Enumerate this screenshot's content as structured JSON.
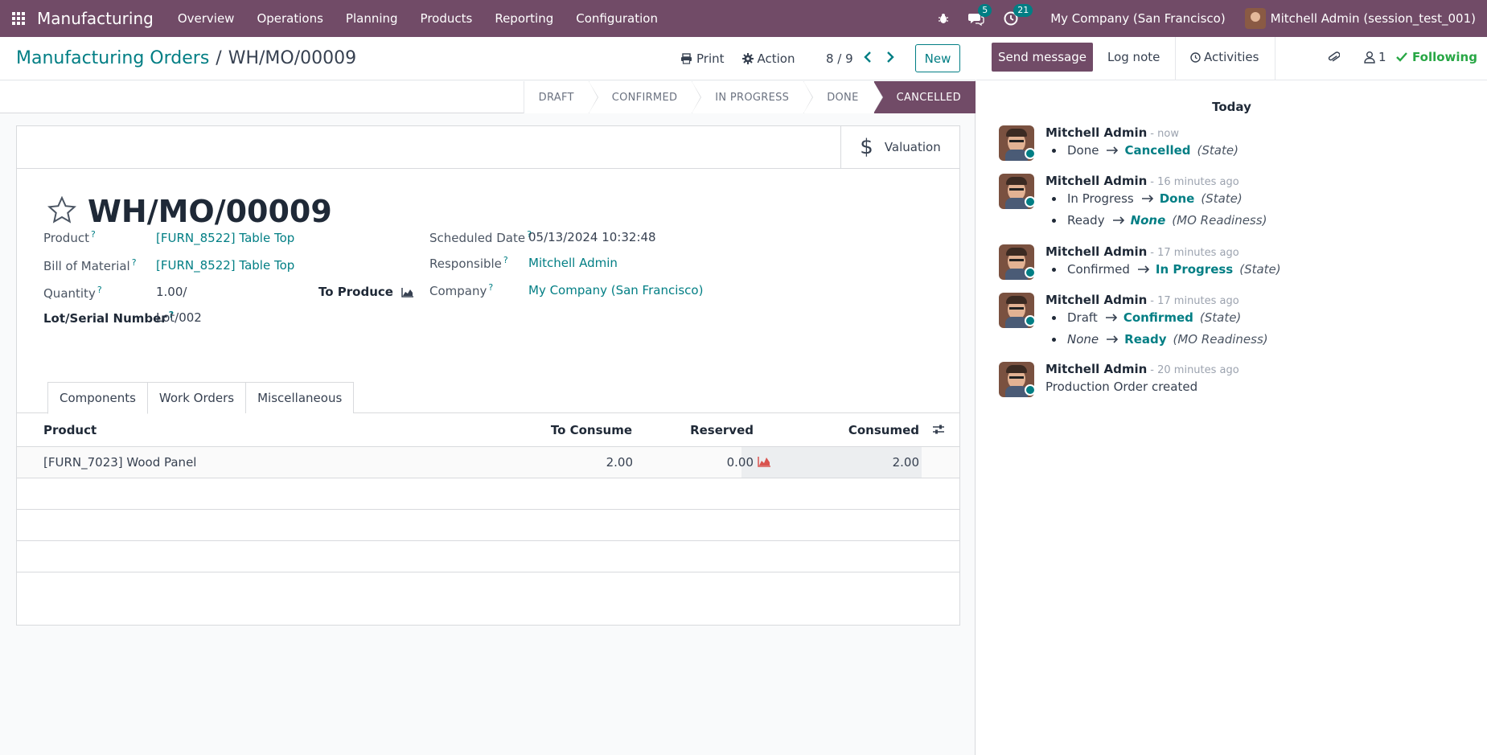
{
  "navbar": {
    "app_name": "Manufacturing",
    "menu": [
      "Overview",
      "Operations",
      "Planning",
      "Products",
      "Reporting",
      "Configuration"
    ],
    "messages_count": "5",
    "activities_count": "21",
    "company": "My Company (San Francisco)",
    "user": "Mitchell Admin (session_test_001)"
  },
  "control_panel": {
    "breadcrumb_parent": "Manufacturing Orders",
    "breadcrumb_sep": "/",
    "breadcrumb_current": "WH/MO/00009",
    "print_label": "Print",
    "action_label": "Action",
    "pager": "8 / 9",
    "new_label": "New"
  },
  "statusbar": {
    "steps": [
      "DRAFT",
      "CONFIRMED",
      "IN PROGRESS",
      "DONE",
      "CANCELLED"
    ],
    "active": "CANCELLED"
  },
  "form": {
    "valuation_label": "Valuation",
    "title": "WH/MO/00009",
    "fields": {
      "product_label": "Product",
      "product_value": "[FURN_8522] Table Top",
      "bom_label": "Bill of Material",
      "bom_value": "[FURN_8522] Table Top",
      "quantity_label": "Quantity",
      "quantity_value": "1.00/",
      "to_produce_label": "To Produce",
      "lot_label": "Lot/Serial Number",
      "lot_value": "Lot/002",
      "scheduled_label": "Scheduled Date",
      "scheduled_value": "05/13/2024 10:32:48",
      "responsible_label": "Responsible",
      "responsible_value": "Mitchell Admin",
      "company_label": "Company",
      "company_value": "My Company (San Francisco)",
      "help_mark": "?"
    },
    "tabs": [
      "Components",
      "Work Orders",
      "Miscellaneous"
    ],
    "table": {
      "headers": {
        "product": "Product",
        "to_consume": "To Consume",
        "reserved": "Reserved",
        "consumed": "Consumed"
      },
      "rows": [
        {
          "product": "[FURN_7023] Wood Panel",
          "to_consume": "2.00",
          "reserved": "0.00",
          "consumed": "2.00"
        }
      ]
    }
  },
  "chatter": {
    "send_message": "Send message",
    "log_note": "Log note",
    "activities": "Activities",
    "followers_count": "1",
    "following": "Following",
    "date_separator": "Today",
    "messages": [
      {
        "author": "Mitchell Admin",
        "time": "- now",
        "changes": [
          {
            "old": "Done",
            "new": "Cancelled",
            "field": "(State)"
          }
        ]
      },
      {
        "author": "Mitchell Admin",
        "time": "- 16 minutes ago",
        "changes": [
          {
            "old": "In Progress",
            "new": "Done",
            "field": "(State)"
          },
          {
            "old": "Ready",
            "new": "None",
            "field": "(MO Readiness)"
          }
        ]
      },
      {
        "author": "Mitchell Admin",
        "time": "- 17 minutes ago",
        "changes": [
          {
            "old": "Confirmed",
            "new": "In Progress",
            "field": "(State)"
          }
        ]
      },
      {
        "author": "Mitchell Admin",
        "time": "- 17 minutes ago",
        "changes": [
          {
            "old": "Draft",
            "new": "Confirmed",
            "field": "(State)"
          },
          {
            "old": "None",
            "new": "Ready",
            "field": "(MO Readiness)"
          }
        ]
      },
      {
        "author": "Mitchell Admin",
        "time": "- 20 minutes ago",
        "body": "Production Order created"
      }
    ]
  },
  "colors": {
    "brand": "#714B67",
    "accent": "#017E84",
    "reserved_chart": "#d9534f"
  },
  "icons": [
    "apps-grid-icon",
    "bug-icon",
    "chat-icon",
    "clock-icon",
    "print-icon",
    "gear-icon",
    "chevron-left-icon",
    "chevron-right-icon",
    "dollar-icon",
    "star-icon",
    "area-chart-icon",
    "settings-sliders-icon",
    "paperclip-icon",
    "user-icon",
    "check-icon",
    "arrow-right-icon"
  ]
}
